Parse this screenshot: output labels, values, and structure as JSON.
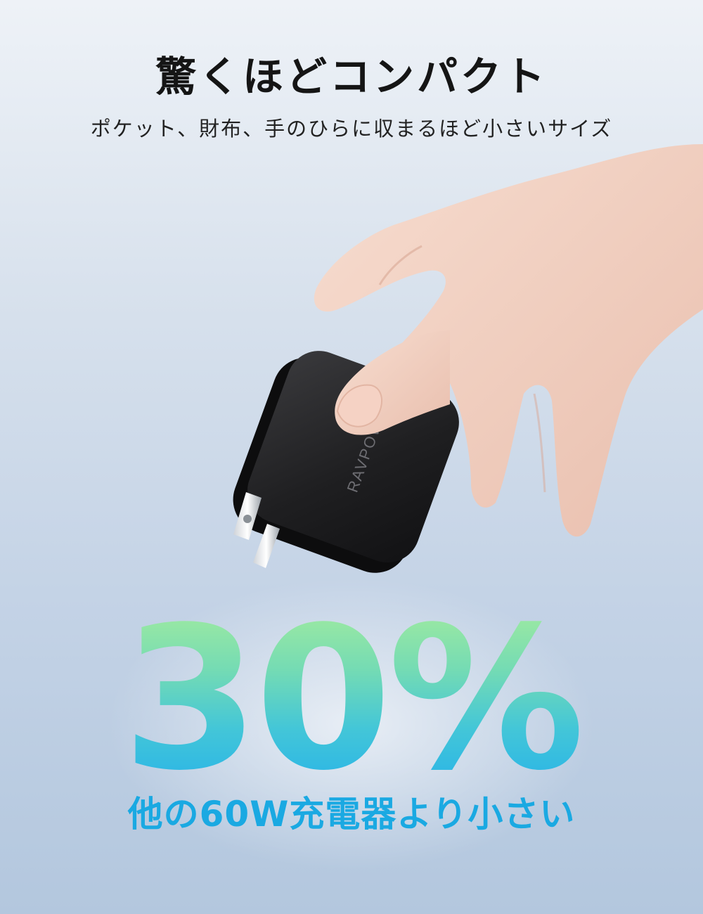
{
  "header": {
    "title": "驚くほどコンパクト",
    "subtitle": "ポケット、財布、手のひらに収まるほど小さいサイズ"
  },
  "product": {
    "brand": "RAVPOWER",
    "body_color": "#1c1c1e"
  },
  "highlight": {
    "value": "30%",
    "caption": "他の60W充電器より小さい",
    "gradient_colors": [
      "#a4ec9e",
      "#43c6d8",
      "#25b1ea"
    ]
  }
}
